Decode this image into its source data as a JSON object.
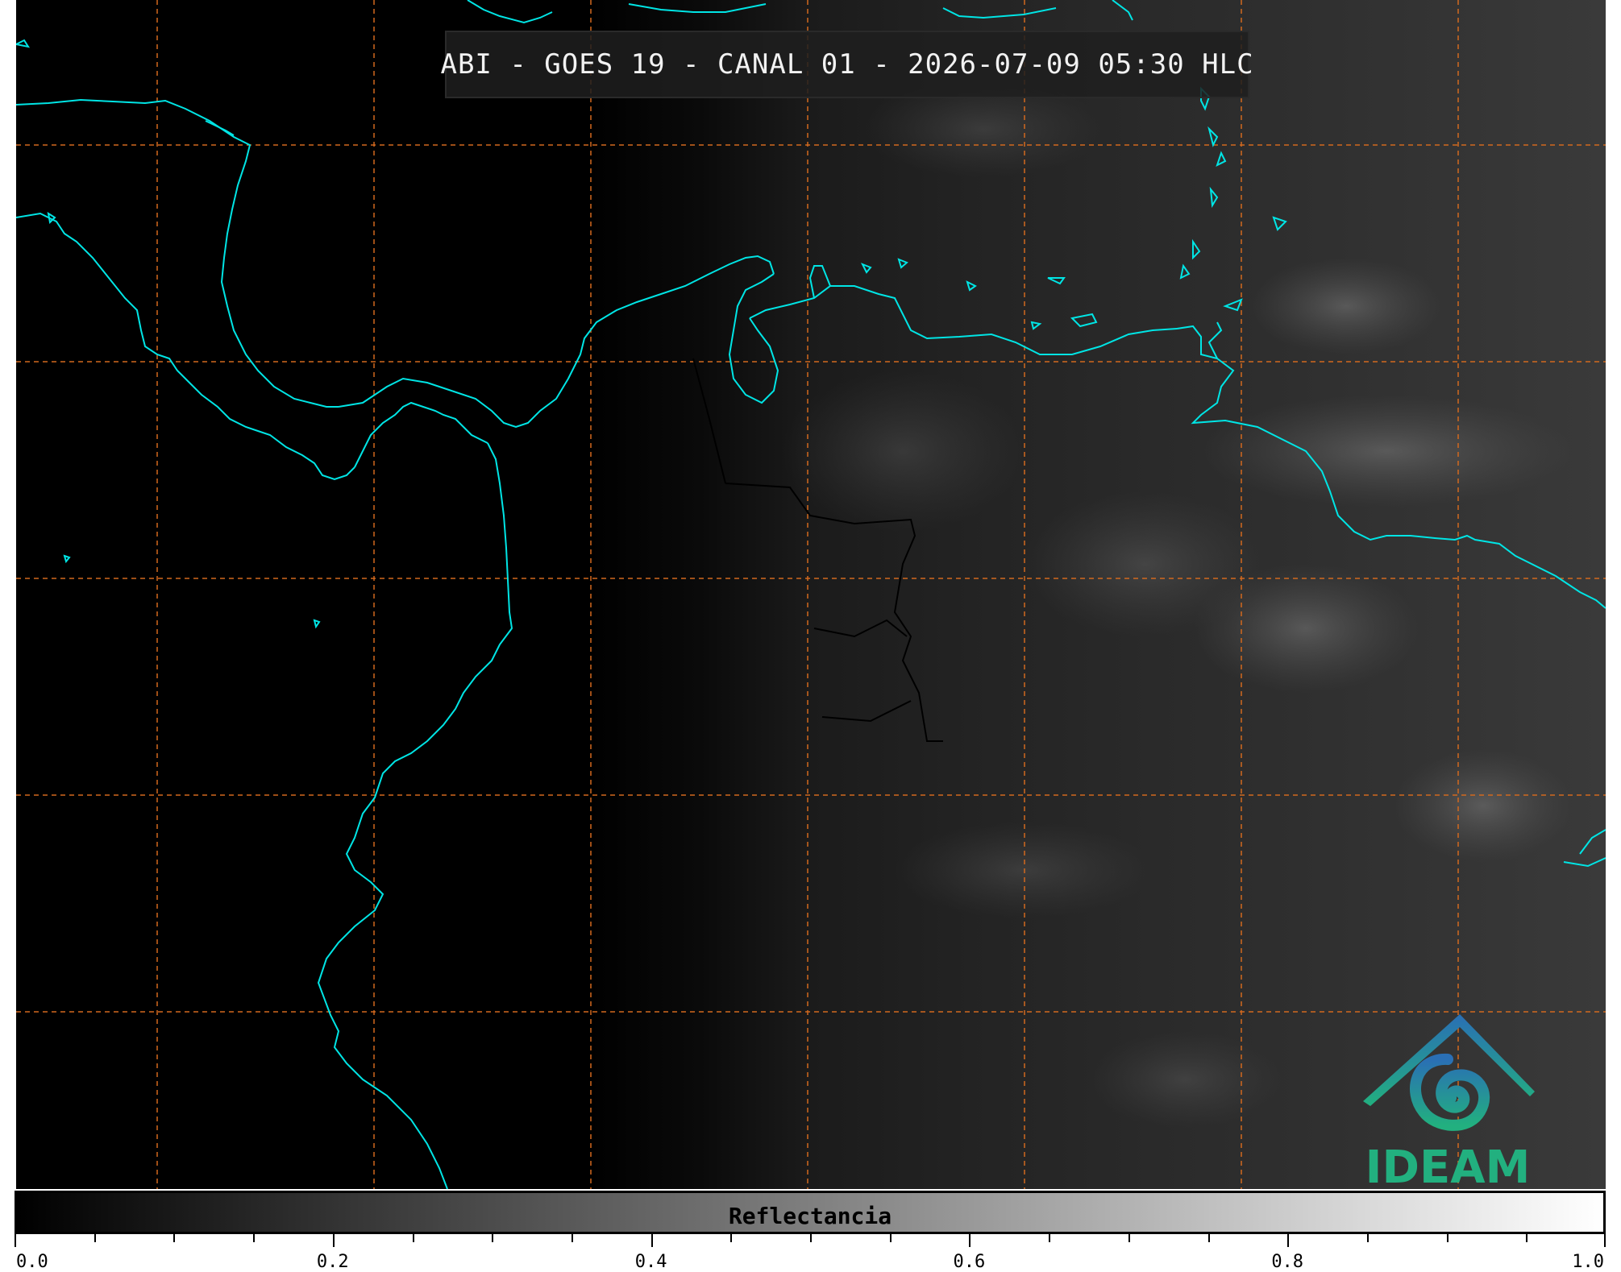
{
  "title": "ABI - GOES 19 - CANAL 01 - 2026-07-09 05:30 HLC",
  "colorbar": {
    "label": "Reflectancia",
    "min": 0.0,
    "max": 1.0,
    "major_ticks": [
      "0.0",
      "0.2",
      "0.4",
      "0.6",
      "0.8",
      "1.0"
    ]
  },
  "logo": {
    "text": "IDEAM"
  },
  "colors": {
    "coastline": "#00e5e5",
    "gridlines": "#d2691e",
    "borders": "#000000",
    "logo_blue": "#2a6fb5",
    "logo_green": "#22b07f"
  }
}
